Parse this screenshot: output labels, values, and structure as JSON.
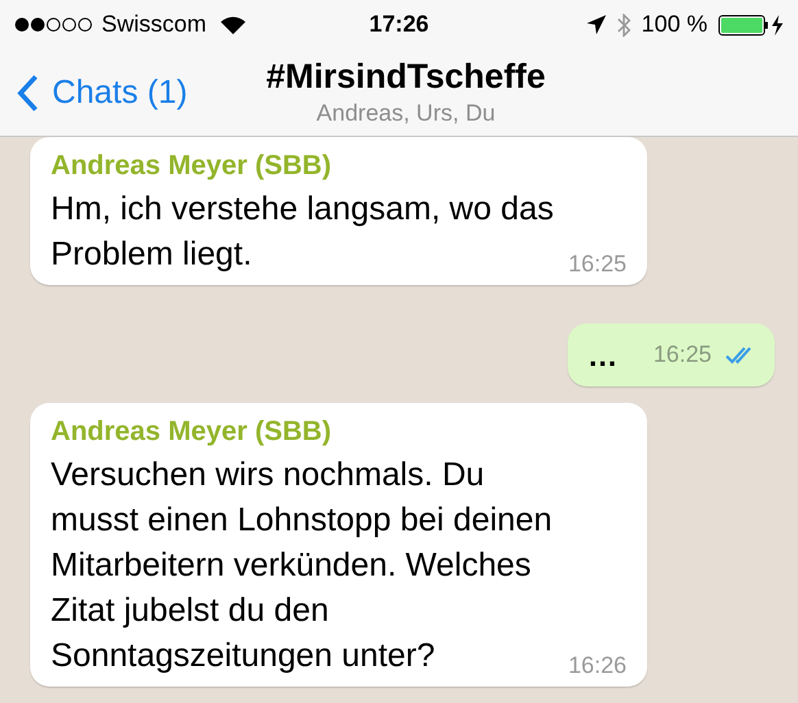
{
  "status_bar": {
    "carrier": "Swisscom",
    "time": "17:26",
    "battery": "100 %"
  },
  "nav": {
    "back": "Chats (1)",
    "title": "#MirsindTscheffe",
    "subtitle": "Andreas, Urs, Du"
  },
  "messages": [
    {
      "kind": "incoming",
      "sender": "Andreas Meyer (SBB)",
      "text": "Hm, ich verstehe langsam, wo das Problem liegt.",
      "time": "16:25"
    },
    {
      "kind": "outgoing",
      "text": "…",
      "time": "16:25",
      "read": true
    },
    {
      "kind": "incoming",
      "sender": "Andreas Meyer (SBB)",
      "text": "Versuchen wirs nochmals. Du musst einen Lohnstopp bei deinen Mitarbeitern verkünden. Welches Zitat jubelst du den Sonntagszeitungen unter?",
      "time": "16:26"
    }
  ]
}
